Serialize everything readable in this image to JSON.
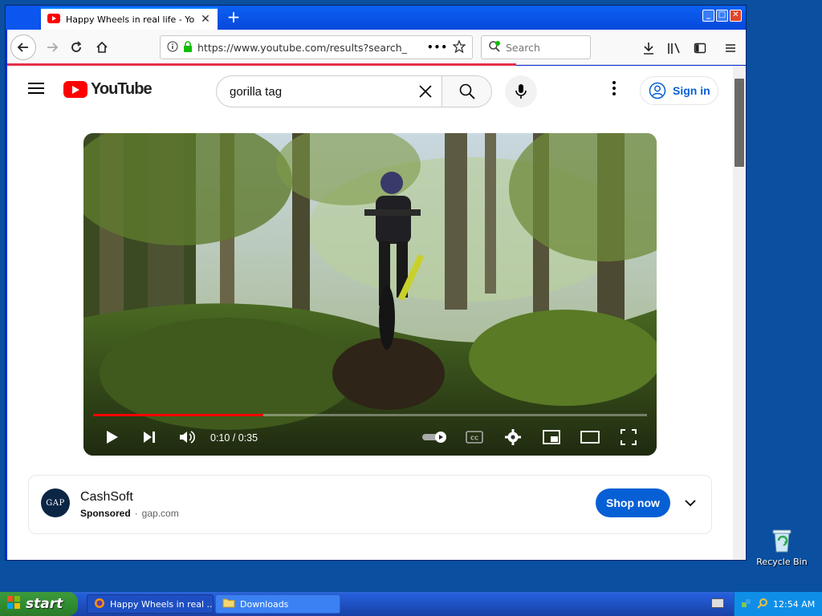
{
  "desktop": {
    "recycle_bin_label": "Recycle Bin"
  },
  "browser": {
    "tab_title": "Happy Wheels in real life - YouTube",
    "url": "https://www.youtube.com/results?search_",
    "search_placeholder": "Search"
  },
  "youtube": {
    "logo_text": "YouTube",
    "search_query": "gorilla tag",
    "sign_in_label": "Sign in"
  },
  "player": {
    "time_label": "0:10 / 0:35",
    "progress_fraction": 0.307
  },
  "ad": {
    "avatar_text": "GAP",
    "advertiser": "CashSoft",
    "sponsored_label": "Sponsored",
    "separator": "·",
    "domain": "gap.com",
    "cta_label": "Shop now"
  },
  "taskbar": {
    "start_label": "start",
    "tasks": [
      {
        "label": "Happy Wheels in real ..."
      },
      {
        "label": "Downloads"
      }
    ],
    "clock": "12:54 AM"
  },
  "colors": {
    "accent_red": "#ff0000",
    "link_blue": "#065fd4"
  }
}
